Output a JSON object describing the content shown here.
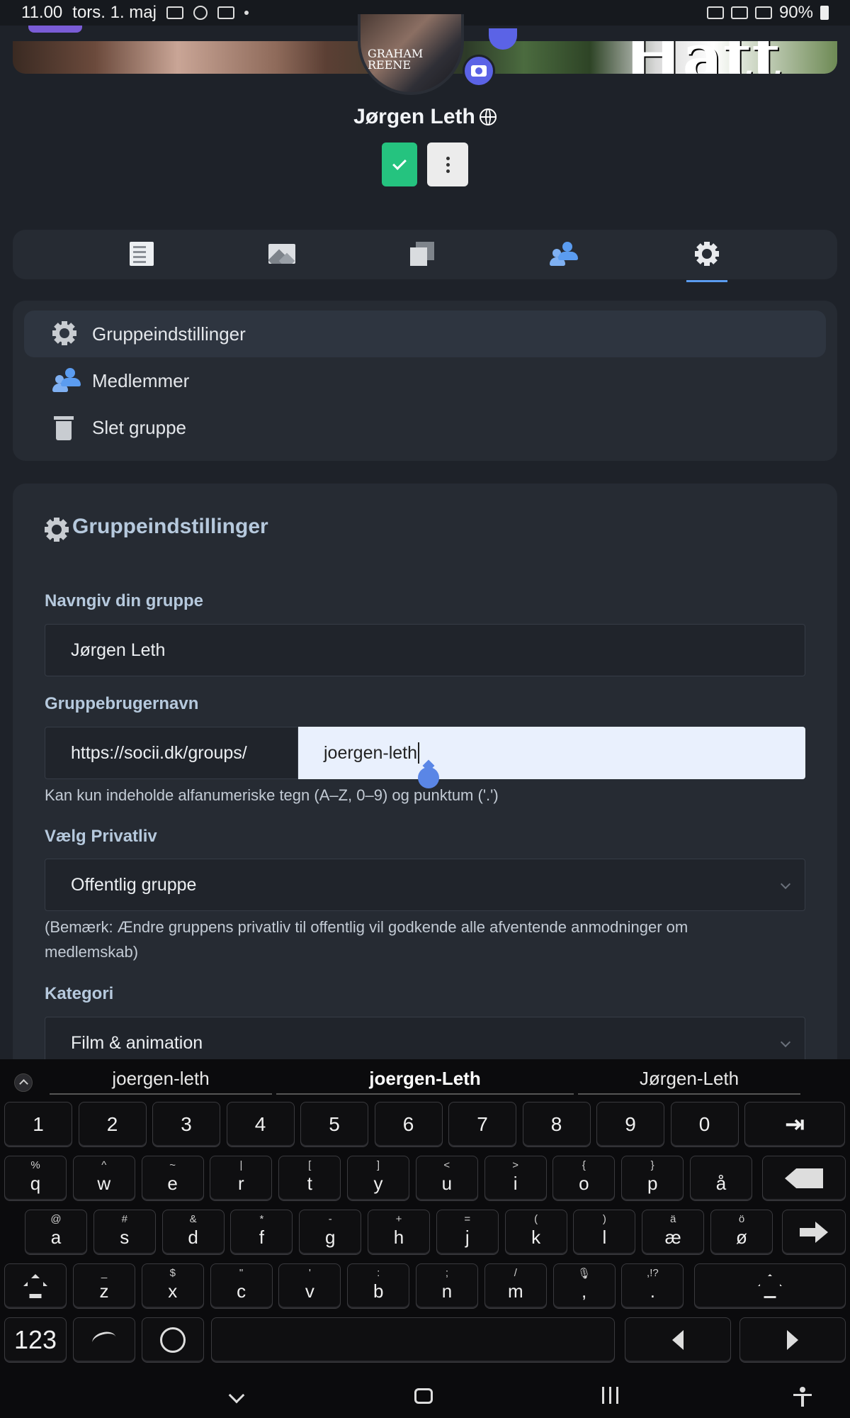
{
  "status_bar": {
    "time": "11.00",
    "date": "tors. 1. maj",
    "battery": "90%"
  },
  "profile": {
    "avatar_caption": "GRAHAM\nREENE",
    "cover_text": "Hatt",
    "name": "Jørgen Leth"
  },
  "tabs": [
    {
      "name": "posts",
      "icon": "document-icon"
    },
    {
      "name": "photos",
      "icon": "image-icon"
    },
    {
      "name": "videos",
      "icon": "video-icon"
    },
    {
      "name": "members",
      "icon": "members-icon"
    },
    {
      "name": "settings",
      "icon": "gear-icon",
      "active": true
    }
  ],
  "settings_menu": {
    "items": [
      {
        "label": "Gruppeindstillinger",
        "icon": "gear-icon",
        "active": true
      },
      {
        "label": "Medlemmer",
        "icon": "members-icon"
      },
      {
        "label": "Slet gruppe",
        "icon": "trash-icon"
      }
    ]
  },
  "form": {
    "title": "Gruppeindstillinger",
    "name_label": "Navngiv din gruppe",
    "name_value": "Jørgen Leth",
    "username_label": "Gruppebrugernavn",
    "url_prefix": "https://socii.dk/groups/",
    "username_value": "joergen-leth",
    "username_hint": "Kan kun indeholde alfanumeriske tegn (A–Z, 0–9) og punktum ('.')",
    "privacy_label": "Vælg Privatliv",
    "privacy_value": "Offentlig gruppe",
    "privacy_note_1": "(Bemærk: Ændre gruppens privatliv til offentlig vil godkende alle afventende anmodninger om",
    "privacy_note_2": "medlemskab)",
    "category_label": "Kategori",
    "category_value": "Film & animation"
  },
  "keyboard": {
    "suggestions": [
      "joergen-leth",
      "joergen-Leth",
      "Jørgen-Leth"
    ],
    "number_row": [
      "1",
      "2",
      "3",
      "4",
      "5",
      "6",
      "7",
      "8",
      "9",
      "0"
    ],
    "row_q": [
      {
        "main": "q",
        "sup": "%"
      },
      {
        "main": "w",
        "sup": "^"
      },
      {
        "main": "e",
        "sup": "~"
      },
      {
        "main": "r",
        "sup": "|"
      },
      {
        "main": "t",
        "sup": "["
      },
      {
        "main": "y",
        "sup": "]"
      },
      {
        "main": "u",
        "sup": "<"
      },
      {
        "main": "i",
        "sup": ">"
      },
      {
        "main": "o",
        "sup": "{"
      },
      {
        "main": "p",
        "sup": "}"
      },
      {
        "main": "å",
        "sup": ""
      }
    ],
    "row_a": [
      {
        "main": "a",
        "sup": "@"
      },
      {
        "main": "s",
        "sup": "#"
      },
      {
        "main": "d",
        "sup": "&"
      },
      {
        "main": "f",
        "sup": "*"
      },
      {
        "main": "g",
        "sup": "-"
      },
      {
        "main": "h",
        "sup": "+"
      },
      {
        "main": "j",
        "sup": "="
      },
      {
        "main": "k",
        "sup": "("
      },
      {
        "main": "l",
        "sup": ")"
      },
      {
        "main": "æ",
        "sup": "ä"
      },
      {
        "main": "ø",
        "sup": "ö"
      }
    ],
    "row_z": [
      {
        "main": "z",
        "sup": "_"
      },
      {
        "main": "x",
        "sup": "$"
      },
      {
        "main": "c",
        "sup": "\""
      },
      {
        "main": "v",
        "sup": "'"
      },
      {
        "main": "b",
        "sup": ":"
      },
      {
        "main": "n",
        "sup": ";"
      },
      {
        "main": "m",
        "sup": "/"
      },
      {
        "main": ",",
        "sup": "🎙"
      },
      {
        "main": ".",
        "sup": ",!?"
      }
    ],
    "symbols_label": "123"
  }
}
